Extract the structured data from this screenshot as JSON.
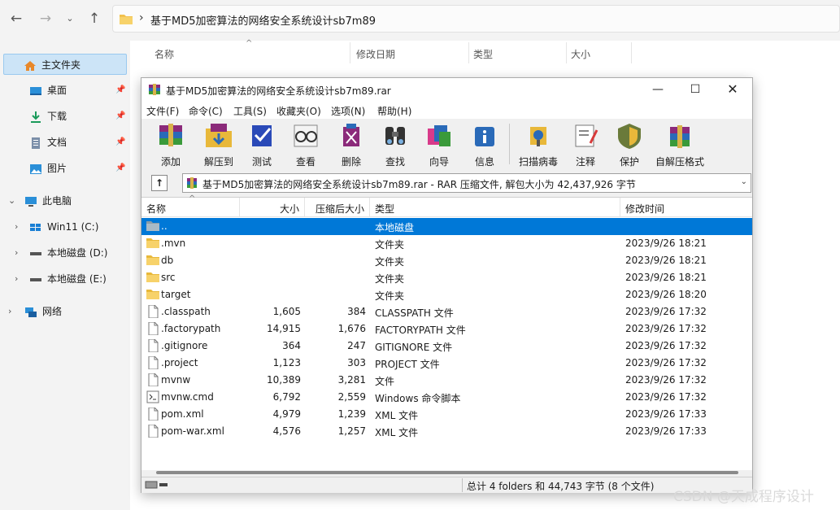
{
  "explorer": {
    "address_path": "基于MD5加密算法的网络安全系统设计sb7m89",
    "columns": [
      "名称",
      "修改日期",
      "类型",
      "大小"
    ],
    "nav": [
      {
        "label": "主文件夹",
        "icon": "home-icon"
      },
      {
        "label": "桌面",
        "icon": "desktop-icon"
      },
      {
        "label": "下载",
        "icon": "download-icon"
      },
      {
        "label": "文档",
        "icon": "document-icon"
      },
      {
        "label": "图片",
        "icon": "picture-icon"
      },
      {
        "label": "此电脑",
        "icon": "computer-icon"
      },
      {
        "label": "Win11 (C:)",
        "icon": "windows-drive-icon"
      },
      {
        "label": "本地磁盘 (D:)",
        "icon": "drive-icon"
      },
      {
        "label": "本地磁盘 (E:)",
        "icon": "drive-icon"
      },
      {
        "label": "网络",
        "icon": "network-icon"
      }
    ]
  },
  "rar": {
    "title": "基于MD5加密算法的网络安全系统设计sb7m89.rar",
    "menu": [
      "文件(F)",
      "命令(C)",
      "工具(S)",
      "收藏夹(O)",
      "选项(N)",
      "帮助(H)"
    ],
    "toolbar": [
      "添加",
      "解压到",
      "测试",
      "查看",
      "删除",
      "查找",
      "向导",
      "信息",
      "扫描病毒",
      "注释",
      "保护",
      "自解压格式"
    ],
    "path": "基于MD5加密算法的网络安全系统设计sb7m89.rar - RAR 压缩文件, 解包大小为 42,437,926 字节",
    "columns": [
      "名称",
      "大小",
      "压缩后大小",
      "类型",
      "修改时间"
    ],
    "rows": [
      {
        "name": "..",
        "size": "",
        "packed": "",
        "type": "本地磁盘",
        "modified": "",
        "icon": "folder-up-icon"
      },
      {
        "name": ".mvn",
        "size": "",
        "packed": "",
        "type": "文件夹",
        "modified": "2023/9/26 18:21",
        "icon": "folder-icon"
      },
      {
        "name": "db",
        "size": "",
        "packed": "",
        "type": "文件夹",
        "modified": "2023/9/26 18:21",
        "icon": "folder-icon"
      },
      {
        "name": "src",
        "size": "",
        "packed": "",
        "type": "文件夹",
        "modified": "2023/9/26 18:21",
        "icon": "folder-icon"
      },
      {
        "name": "target",
        "size": "",
        "packed": "",
        "type": "文件夹",
        "modified": "2023/9/26 18:20",
        "icon": "folder-icon"
      },
      {
        "name": ".classpath",
        "size": "1,605",
        "packed": "384",
        "type": "CLASSPATH 文件",
        "modified": "2023/9/26 17:32",
        "icon": "file-icon"
      },
      {
        "name": ".factorypath",
        "size": "14,915",
        "packed": "1,676",
        "type": "FACTORYPATH 文件",
        "modified": "2023/9/26 17:32",
        "icon": "file-icon"
      },
      {
        "name": ".gitignore",
        "size": "364",
        "packed": "247",
        "type": "GITIGNORE 文件",
        "modified": "2023/9/26 17:32",
        "icon": "file-icon"
      },
      {
        "name": ".project",
        "size": "1,123",
        "packed": "303",
        "type": "PROJECT 文件",
        "modified": "2023/9/26 17:32",
        "icon": "file-icon"
      },
      {
        "name": "mvnw",
        "size": "10,389",
        "packed": "3,281",
        "type": "文件",
        "modified": "2023/9/26 17:32",
        "icon": "file-icon"
      },
      {
        "name": "mvnw.cmd",
        "size": "6,792",
        "packed": "2,559",
        "type": "Windows 命令脚本",
        "modified": "2023/9/26 17:32",
        "icon": "script-icon"
      },
      {
        "name": "pom.xml",
        "size": "4,979",
        "packed": "1,239",
        "type": "XML 文件",
        "modified": "2023/9/26 17:33",
        "icon": "file-icon"
      },
      {
        "name": "pom-war.xml",
        "size": "4,576",
        "packed": "1,257",
        "type": "XML 文件",
        "modified": "2023/9/26 17:33",
        "icon": "file-icon"
      }
    ],
    "status": "总计 4 folders 和 44,743 字节 (8 个文件)"
  },
  "watermark": "CSDN @天成程序设计",
  "colors": {
    "selection": "#0078d7",
    "nav_selected": "#cce4f7",
    "folder": "#f2c14e"
  }
}
